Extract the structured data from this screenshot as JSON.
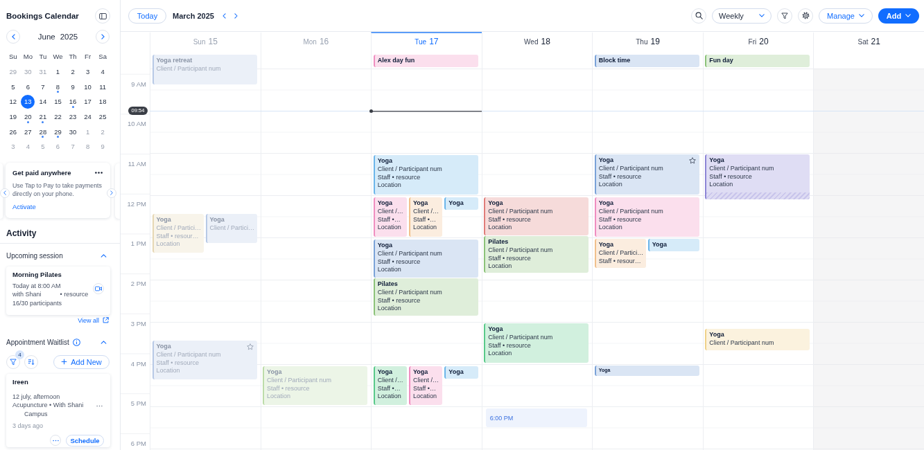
{
  "sidebar": {
    "title": "Bookings Calendar",
    "mini_calendar": {
      "month": "June",
      "year": "2025",
      "weekdays": [
        "Su",
        "Mo",
        "Tu",
        "We",
        "Th",
        "Fr",
        "Sa"
      ],
      "days": [
        {
          "label": "29",
          "outside": true,
          "selected": false,
          "dot": false
        },
        {
          "label": "30",
          "outside": true,
          "selected": false,
          "dot": false
        },
        {
          "label": "31",
          "outside": true,
          "selected": false,
          "dot": false
        },
        {
          "label": "1",
          "outside": false,
          "selected": false,
          "dot": false
        },
        {
          "label": "2",
          "outside": false,
          "selected": false,
          "dot": false
        },
        {
          "label": "3",
          "outside": false,
          "selected": false,
          "dot": false
        },
        {
          "label": "4",
          "outside": false,
          "selected": false,
          "dot": false
        },
        {
          "label": "5",
          "outside": false,
          "selected": false,
          "dot": false
        },
        {
          "label": "6",
          "outside": false,
          "selected": false,
          "dot": false
        },
        {
          "label": "7",
          "outside": false,
          "selected": false,
          "dot": false
        },
        {
          "label": "8",
          "outside": false,
          "selected": false,
          "dot": true
        },
        {
          "label": "9",
          "outside": false,
          "selected": false,
          "dot": false
        },
        {
          "label": "10",
          "outside": false,
          "selected": false,
          "dot": false
        },
        {
          "label": "11",
          "outside": false,
          "selected": false,
          "dot": false
        },
        {
          "label": "12",
          "outside": false,
          "selected": false,
          "dot": false
        },
        {
          "label": "13",
          "outside": false,
          "selected": true,
          "dot": false
        },
        {
          "label": "14",
          "outside": false,
          "selected": false,
          "dot": false
        },
        {
          "label": "15",
          "outside": false,
          "selected": false,
          "dot": false
        },
        {
          "label": "16",
          "outside": false,
          "selected": false,
          "dot": true
        },
        {
          "label": "17",
          "outside": false,
          "selected": false,
          "dot": false
        },
        {
          "label": "18",
          "outside": false,
          "selected": false,
          "dot": false
        },
        {
          "label": "19",
          "outside": false,
          "selected": false,
          "dot": false
        },
        {
          "label": "20",
          "outside": false,
          "selected": false,
          "dot": true
        },
        {
          "label": "21",
          "outside": false,
          "selected": false,
          "dot": true
        },
        {
          "label": "22",
          "outside": false,
          "selected": false,
          "dot": false
        },
        {
          "label": "23",
          "outside": false,
          "selected": false,
          "dot": false
        },
        {
          "label": "24",
          "outside": false,
          "selected": false,
          "dot": false
        },
        {
          "label": "25",
          "outside": false,
          "selected": false,
          "dot": false
        },
        {
          "label": "26",
          "outside": false,
          "selected": false,
          "dot": false
        },
        {
          "label": "27",
          "outside": false,
          "selected": false,
          "dot": false
        },
        {
          "label": "28",
          "outside": false,
          "selected": false,
          "dot": true
        },
        {
          "label": "29",
          "outside": false,
          "selected": false,
          "dot": true
        },
        {
          "label": "30",
          "outside": false,
          "selected": false,
          "dot": false
        },
        {
          "label": "1",
          "outside": true,
          "selected": false,
          "dot": false
        },
        {
          "label": "2",
          "outside": true,
          "selected": false,
          "dot": false
        },
        {
          "label": "3",
          "outside": true,
          "selected": false,
          "dot": false
        },
        {
          "label": "4",
          "outside": true,
          "selected": false,
          "dot": false
        },
        {
          "label": "5",
          "outside": true,
          "selected": false,
          "dot": false
        },
        {
          "label": "6",
          "outside": true,
          "selected": false,
          "dot": false
        },
        {
          "label": "7",
          "outside": true,
          "selected": false,
          "dot": false
        },
        {
          "label": "8",
          "outside": true,
          "selected": false,
          "dot": false
        },
        {
          "label": "9",
          "outside": true,
          "selected": false,
          "dot": false
        }
      ]
    },
    "promo": {
      "title": "Get paid anywhere",
      "text": "Use Tap to Pay to take payments directly on your phone.",
      "link": "Activate"
    },
    "activity": {
      "title": "Activity",
      "upcoming": {
        "title": "Upcoming session",
        "expanded": true,
        "session": {
          "name": "Morning Pilates",
          "time": "Today at 8:00 AM",
          "staff": "with Shani",
          "resource": "• resource",
          "participants": "16/30 participants"
        },
        "view_all": "View all"
      },
      "waitlist": {
        "title": "Appointment Waitlist",
        "expanded": true,
        "filter_count": "4",
        "add_label": "Add New",
        "entry": {
          "name": "Ireen",
          "when": "12 july, afternoon",
          "service": "Acupuncture • With Shani",
          "location": "Campus",
          "age": "3 days ago",
          "action": "Schedule"
        }
      }
    }
  },
  "toolbar": {
    "today": "Today",
    "period": "March 2025",
    "view": "Weekly",
    "manage": "Manage",
    "add": "Add"
  },
  "calendar": {
    "hours": [
      "9 AM",
      "10 AM",
      "11 AM",
      "12 PM",
      "1 PM",
      "2 PM",
      "3 PM",
      "4 PM",
      "5 PM",
      "6 PM"
    ],
    "now": "09:54",
    "days": [
      {
        "weekday": "Sun",
        "date": "15",
        "past": true,
        "selected": false,
        "unavailable": false,
        "events": [
          {
            "kind": "booking",
            "title": "Yoga retreat",
            "lines": [
              "Client / Participant num"
            ],
            "color": "#b7c9e6",
            "starred": false,
            "buffer": false
          },
          {
            "kind": "booking",
            "title": "Yoga",
            "lines": [
              "Client / Partici…",
              "Staff • resour…",
              "Location"
            ],
            "color": "#e6d7b3",
            "starred": false,
            "buffer": false
          },
          {
            "kind": "booking",
            "title": "Yoga",
            "lines": [
              "Client / Partici…"
            ],
            "color": "#b7c9e6",
            "starred": false,
            "buffer": false
          },
          {
            "kind": "booking",
            "title": "Yoga",
            "lines": [
              "Client / Participant num",
              "Staff • resource",
              "Location"
            ],
            "color": "#b7c9e6",
            "starred": true,
            "buffer": false
          }
        ]
      },
      {
        "weekday": "Mon",
        "date": "16",
        "past": true,
        "selected": false,
        "unavailable": false,
        "events": [
          {
            "kind": "booking",
            "title": "Yoga",
            "lines": [
              "Client / Participant num",
              "Staff • resource",
              "Location"
            ],
            "color": "#bcdcaa",
            "starred": false,
            "buffer": false
          }
        ]
      },
      {
        "weekday": "Tue",
        "date": "17",
        "past": false,
        "selected": true,
        "unavailable": false,
        "events": [
          {
            "kind": "booking",
            "title": "Alex day fun",
            "color": "#ef8ec0",
            "starred": false,
            "buffer": false
          },
          {
            "kind": "booking",
            "title": "Yoga",
            "lines": [
              "Client / Participant num",
              "Staff • resource",
              "Location"
            ],
            "color": "#6cb6ea",
            "starred": false,
            "buffer": false
          },
          {
            "kind": "booking",
            "title": "Yoga",
            "lines": [
              "Client /…",
              "Staff •…",
              "Location"
            ],
            "color": "#ef8ec0",
            "starred": false,
            "buffer": false
          },
          {
            "kind": "booking",
            "title": "Yoga",
            "lines": [
              "Client /…",
              "Staff •…",
              "Location"
            ],
            "color": "#f1c08c",
            "starred": false,
            "buffer": false
          },
          {
            "kind": "booking",
            "title": "Yoga",
            "color": "#6cb6ea",
            "starred": false,
            "buffer": false
          },
          {
            "kind": "booking",
            "title": "Yoga",
            "lines": [
              "Client / Participant num",
              "Staff • resource",
              "Location"
            ],
            "color": "#7aa2d8",
            "starred": false,
            "buffer": false
          },
          {
            "kind": "booking",
            "title": "Pilates",
            "lines": [
              "Client / Participant num",
              "Staff • resource",
              "Location"
            ],
            "color": "#8cc27a",
            "starred": false,
            "buffer": false
          },
          {
            "kind": "booking",
            "title": "Yoga",
            "lines": [
              "Client /…",
              "Staff •…",
              "Location"
            ],
            "color": "#59c98a",
            "starred": false,
            "buffer": false
          },
          {
            "kind": "booking",
            "title": "Yoga",
            "lines": [
              "Client /…",
              "Staff •…",
              "Location"
            ],
            "color": "#ef8ec0",
            "starred": false,
            "buffer": false
          },
          {
            "kind": "booking",
            "title": "Yoga",
            "color": "#6cb6ea",
            "starred": false,
            "buffer": false
          }
        ]
      },
      {
        "weekday": "Wed",
        "date": "18",
        "past": false,
        "selected": false,
        "unavailable": false,
        "events": [
          {
            "kind": "booking",
            "title": "Yoga",
            "lines": [
              "Client / Participant num",
              "Staff • resource",
              "Location"
            ],
            "color": "#e07d7a",
            "starred": false,
            "buffer": false
          },
          {
            "kind": "booking",
            "title": "Pilates",
            "lines": [
              "Client / Participant num",
              "Staff • resource",
              "Location"
            ],
            "color": "#8cc27a",
            "starred": false,
            "buffer": false
          },
          {
            "kind": "booking",
            "title": "Yoga",
            "lines": [
              "Client / Participant num",
              "Staff • resource",
              "Location"
            ],
            "color": "#59c98a",
            "starred": false,
            "buffer": false
          },
          {
            "kind": "slot",
            "title": "6:00 PM"
          }
        ]
      },
      {
        "weekday": "Thu",
        "date": "19",
        "past": false,
        "selected": false,
        "unavailable": false,
        "events": [
          {
            "kind": "booking",
            "title": "Block time",
            "color": "#7aa2d8",
            "starred": false,
            "buffer": false
          },
          {
            "kind": "booking",
            "title": "Yoga",
            "lines": [
              "Client / Participant num",
              "Staff • resource",
              "Location"
            ],
            "color": "#7aa2d8",
            "starred": true,
            "buffer": false
          },
          {
            "kind": "booking",
            "title": "Yoga",
            "lines": [
              "Client / Participant num",
              "Staff • resource",
              "Location"
            ],
            "color": "#ef8ec0",
            "starred": false,
            "buffer": false
          },
          {
            "kind": "booking",
            "title": "Yoga",
            "lines": [
              "Client / Partici…",
              "Staff • resour…"
            ],
            "color": "#f1c08c",
            "starred": false,
            "buffer": false
          },
          {
            "kind": "booking",
            "title": "Yoga",
            "color": "#6cb6ea",
            "starred": false,
            "buffer": false
          },
          {
            "kind": "mini",
            "title": "Yoga",
            "color": "#7aa2d8",
            "starred": false,
            "buffer": false
          }
        ]
      },
      {
        "weekday": "Fri",
        "date": "20",
        "past": false,
        "selected": false,
        "unavailable": false,
        "events": [
          {
            "kind": "booking",
            "title": "Fun day",
            "color": "#8cc27a",
            "starred": false,
            "buffer": false
          },
          {
            "kind": "booking",
            "title": "Yoga",
            "lines": [
              "Client / Participant num",
              "Staff • resource",
              "Location"
            ],
            "color": "#8e86d6",
            "starred": false,
            "buffer": true
          },
          {
            "kind": "booking",
            "title": "Yoga",
            "lines": [
              "Client / Participant num"
            ],
            "color": "#efd28a",
            "starred": false,
            "buffer": false
          }
        ]
      },
      {
        "weekday": "Sat",
        "date": "21",
        "past": false,
        "selected": false,
        "unavailable": true
      }
    ]
  }
}
